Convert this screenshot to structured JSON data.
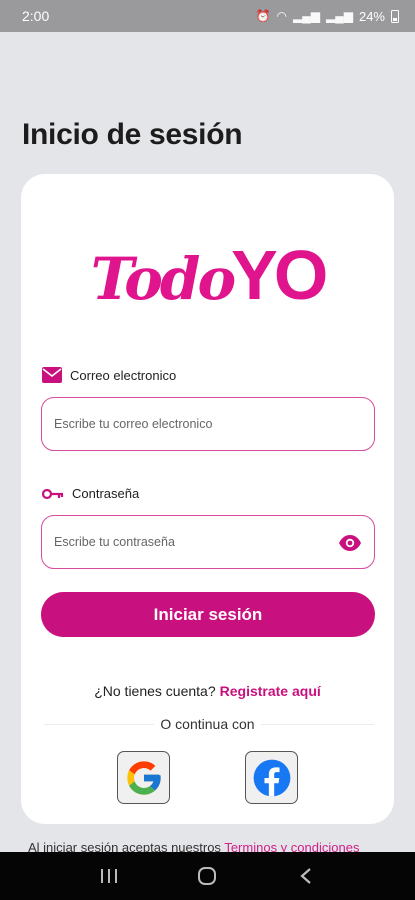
{
  "status_bar": {
    "time": "2:00",
    "battery": "24%",
    "icons": [
      "alarm-icon",
      "wifi-icon",
      "signal-icon",
      "signal-icon",
      "battery-icon"
    ]
  },
  "page_title": "Inicio de sesión",
  "logo": {
    "part1": "Todo",
    "part2": "YO",
    "color": "#e0148c"
  },
  "email": {
    "label": "Correo electronico",
    "placeholder": "Escribe tu correo electronico",
    "value": "",
    "icon": "mail-icon"
  },
  "password": {
    "label": "Contraseña",
    "placeholder": "Escribe tu contraseña",
    "value": "",
    "icon": "key-icon",
    "toggle_icon": "eye-icon"
  },
  "login_button": "Iniciar sesión",
  "register": {
    "prompt": "¿No tienes cuenta?",
    "link": "Registrate aquí"
  },
  "or_continue": "O continua con",
  "social": [
    "google-icon",
    "facebook-icon"
  ],
  "terms": {
    "prefix": "Al iniciar sesión aceptas nuestros",
    "link": "Terminos y condiciones"
  },
  "colors": {
    "accent": "#c8107e",
    "border": "#d64aa0",
    "background": "#e4e5e8"
  },
  "nav": [
    "recent-apps-icon",
    "home-icon",
    "back-icon"
  ]
}
